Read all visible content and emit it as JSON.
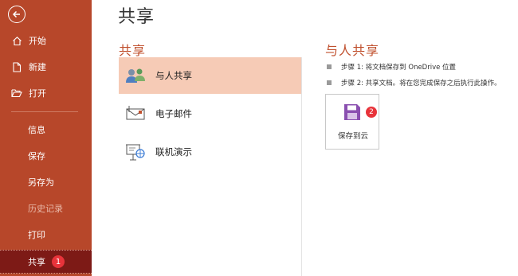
{
  "sidebar": {
    "items": [
      {
        "label": "开始",
        "icon": "home-icon"
      },
      {
        "label": "新建",
        "icon": "new-doc-icon"
      },
      {
        "label": "打开",
        "icon": "folder-open-icon"
      },
      {
        "label": "信息"
      },
      {
        "label": "保存"
      },
      {
        "label": "另存为"
      },
      {
        "label": "历史记录"
      },
      {
        "label": "打印"
      },
      {
        "label": "共享",
        "badge": "1"
      }
    ],
    "accent": "#b7472a",
    "active_bg": "#7d1a16"
  },
  "main": {
    "title": "共享",
    "share_section_title": "共享",
    "share_options": [
      {
        "label": "与人共享",
        "icon": "people-icon"
      },
      {
        "label": "电子邮件",
        "icon": "email-icon"
      },
      {
        "label": "联机演示",
        "icon": "online-presentation-icon"
      }
    ],
    "panel": {
      "title": "与人共享",
      "steps": [
        "步骤 1: 将文档保存到 OneDrive 位置",
        "步骤 2: 共享文档。将在您完成保存之后执行此操作。"
      ],
      "save_button_label": "保存到云",
      "save_badge": "2"
    },
    "selected_bg": "#f6cbb6",
    "title_color": "#c0502e"
  }
}
